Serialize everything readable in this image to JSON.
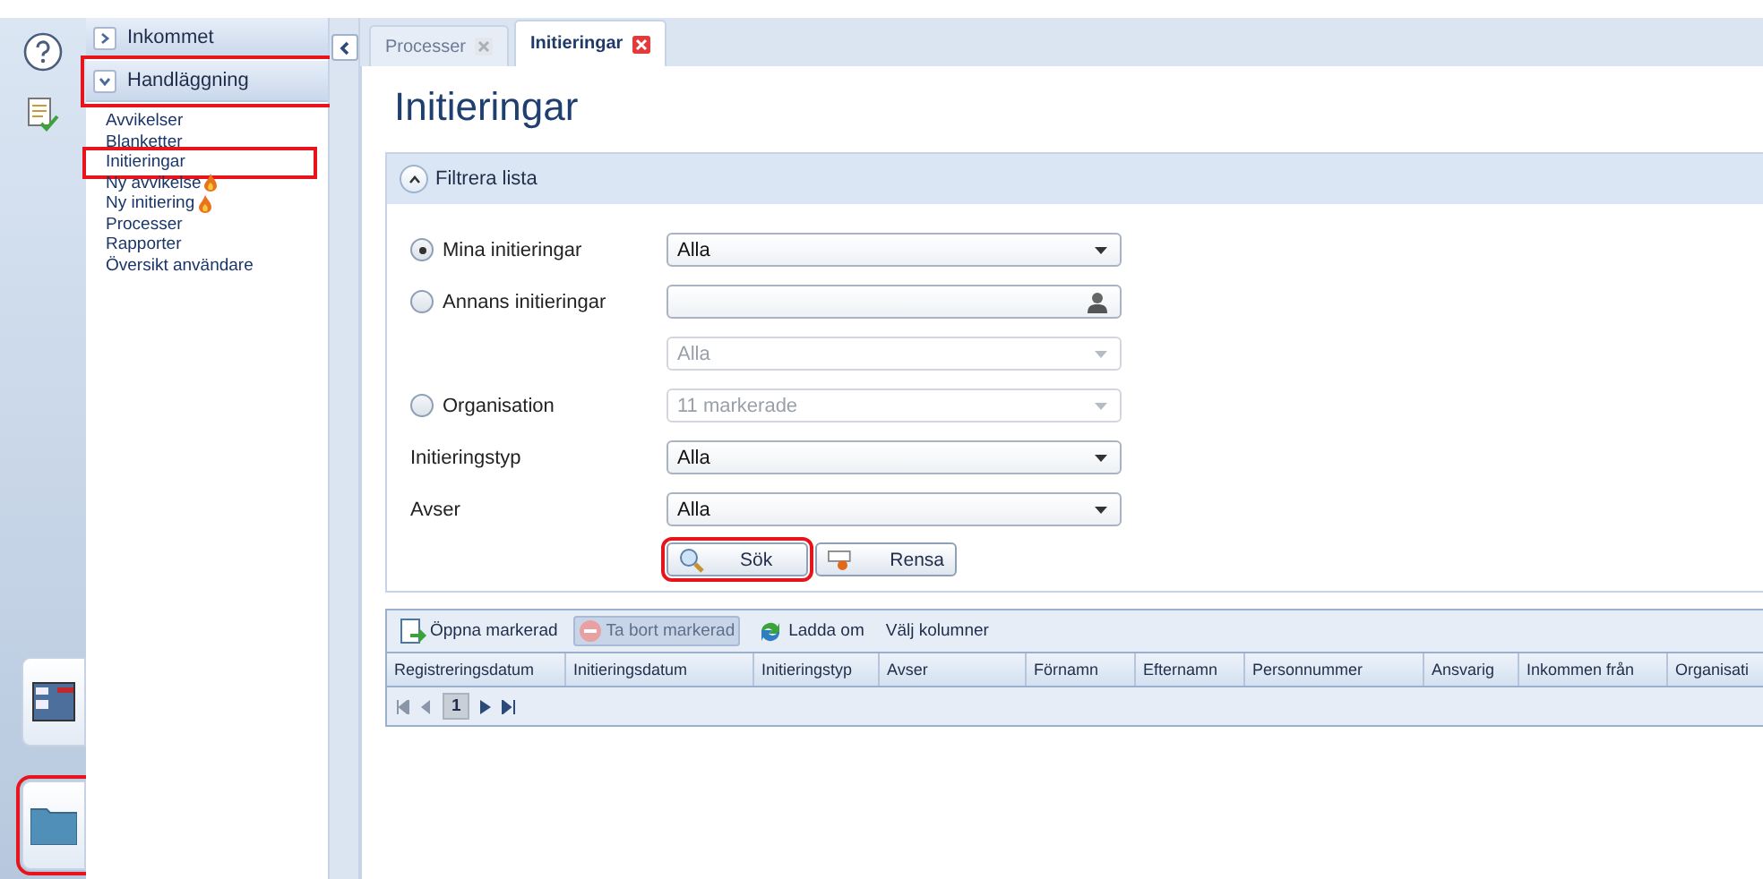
{
  "rail": {
    "tabs": [
      {
        "kind": "panels",
        "highlighted": false
      },
      {
        "kind": "folder",
        "highlighted": true
      }
    ]
  },
  "nav": {
    "groups": [
      {
        "label": "Inkommet",
        "expanded": false,
        "highlighted": false
      },
      {
        "label": "Handläggning",
        "expanded": true,
        "highlighted": true,
        "items": [
          {
            "label": "Avvikelser",
            "highlighted": false,
            "flagged": false
          },
          {
            "label": "Blanketter",
            "highlighted": false,
            "flagged": false
          },
          {
            "label": "Initieringar",
            "highlighted": true,
            "flagged": false
          },
          {
            "label": "Ny avvikelse",
            "highlighted": false,
            "flagged": true
          },
          {
            "label": "Ny initiering",
            "highlighted": false,
            "flagged": true
          },
          {
            "label": "Processer",
            "highlighted": false,
            "flagged": false
          },
          {
            "label": "Rapporter",
            "highlighted": false,
            "flagged": false
          },
          {
            "label": "Översikt användare",
            "highlighted": false,
            "flagged": false
          }
        ]
      }
    ]
  },
  "tabs": [
    {
      "label": "Processer",
      "selected": false
    },
    {
      "label": "Initieringar",
      "selected": true
    }
  ],
  "page_title": "Initieringar",
  "filter": {
    "title": "Filtrera lista",
    "expanded": true,
    "rows": [
      {
        "kind": "radio",
        "label": "Mina initieringar",
        "selected": true,
        "field": {
          "kind": "select",
          "value": "Alla",
          "disabled": false
        }
      },
      {
        "kind": "radio",
        "label": "Annans initieringar",
        "selected": false,
        "field": {
          "kind": "person",
          "disabled": false
        }
      },
      {
        "kind": "none",
        "field": {
          "kind": "select",
          "value": "Alla",
          "disabled": true
        }
      },
      {
        "kind": "radio",
        "label": "Organisation",
        "selected": false,
        "field": {
          "kind": "select",
          "value": "11 markerade",
          "disabled": true
        }
      },
      {
        "kind": "label",
        "label": "Initieringstyp",
        "field": {
          "kind": "select",
          "value": "Alla",
          "disabled": false
        }
      },
      {
        "kind": "label",
        "label": "Avser",
        "field": {
          "kind": "select",
          "value": "Alla",
          "disabled": false
        }
      }
    ],
    "buttons": [
      {
        "kind": "search",
        "label": "Sök",
        "highlighted": true
      },
      {
        "kind": "clear",
        "label": "Rensa",
        "highlighted": false
      }
    ]
  },
  "grid": {
    "toolbar": [
      {
        "kind": "open",
        "label": "Öppna markerad",
        "disabled": false
      },
      {
        "kind": "delete",
        "label": "Ta bort markerad",
        "disabled": true
      },
      {
        "kind": "reload",
        "label": "Ladda om",
        "disabled": false
      },
      {
        "kind": "columns",
        "label": "Välj kolumner",
        "disabled": false
      }
    ],
    "columns": [
      "Registreringsdatum",
      "Initieringsdatum",
      "Initieringstyp",
      "Avser",
      "Förnamn",
      "Efternamn",
      "Personnummer",
      "Ansvarig",
      "Inkommen från",
      "Organisati"
    ],
    "pager": {
      "page": "1"
    }
  }
}
